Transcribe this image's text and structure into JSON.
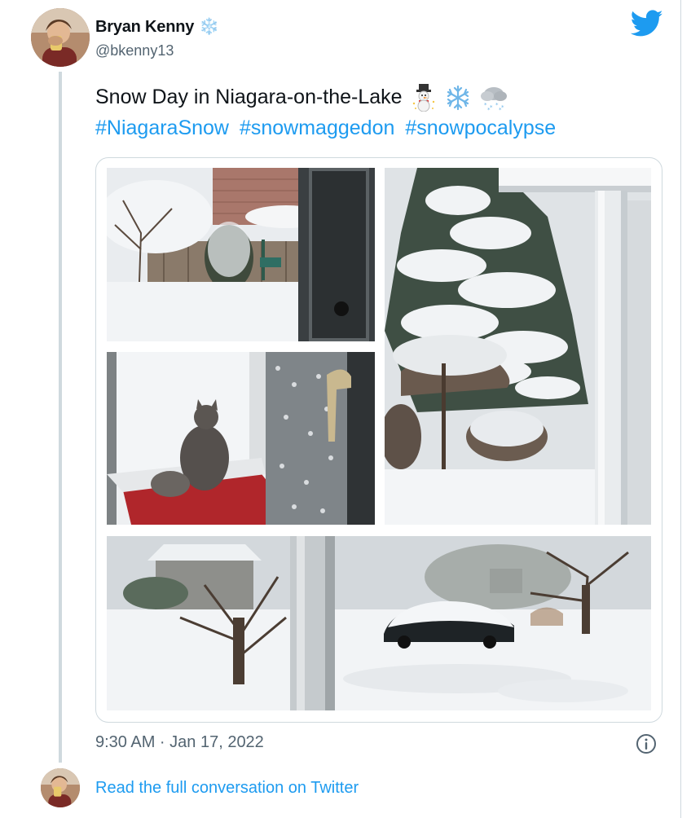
{
  "author": {
    "name": "Bryan Kenny",
    "name_emoji": "❄️",
    "handle": "@bkenny13"
  },
  "tweet": {
    "text": "Snow Day in Niagara-on-the-Lake",
    "emojis": [
      "snowman-icon",
      "snowflake-icon",
      "snow-cloud-icon"
    ],
    "hashtags": [
      "#NiagaraSnow",
      "#snowmaggedon",
      "#snowpocalypse"
    ]
  },
  "media": {
    "photos": [
      {
        "name": "photo-snowy-backyard"
      },
      {
        "name": "photo-snowy-evergreen-porch"
      },
      {
        "name": "photo-cat-at-door"
      },
      {
        "name": "photo-snowy-street-car"
      }
    ]
  },
  "footer": {
    "timestamp": "9:30 AM · Jan 17, 2022",
    "read_more": "Read the full conversation on Twitter"
  },
  "colors": {
    "link": "#1d9bf0",
    "text": "#0f1419",
    "muted": "#536471",
    "border": "#cfd9de"
  }
}
